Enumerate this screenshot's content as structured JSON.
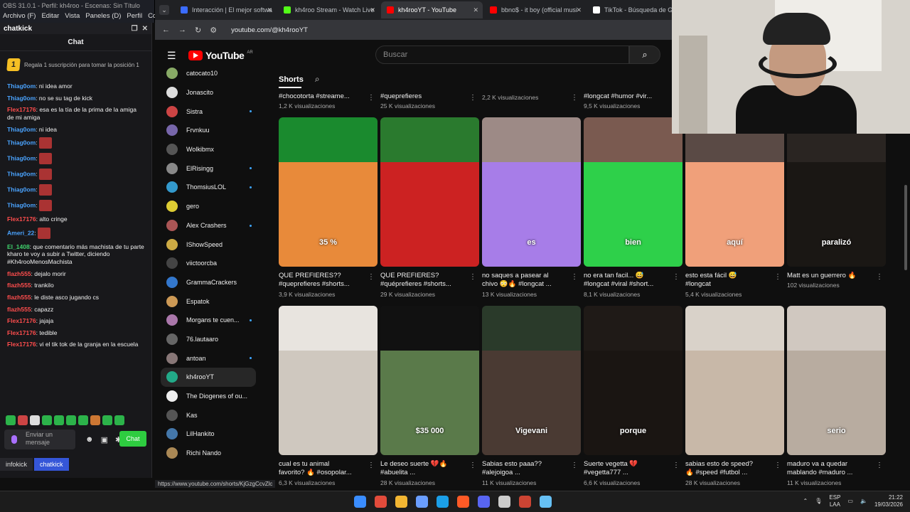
{
  "obs": {
    "title": "OBS 31.0.1 - Perfil: kh4roo - Escenas: Sin Título",
    "menu": [
      "Archivo (F)",
      "Editar",
      "Vista",
      "Paneles (D)",
      "Perfil",
      "Co"
    ]
  },
  "chat": {
    "dock_title": "chatkick",
    "header": "Chat",
    "promo_badge": "1",
    "promo_text": "Regala 1 suscripción para tomar la posición 1",
    "messages": [
      {
        "user": "Thiag0om",
        "text": ": ni idea amor",
        "color": "#4aa3ff"
      },
      {
        "user": "Thiag0om",
        "text": ": no se su tag de kick",
        "color": "#4aa3ff"
      },
      {
        "user": "Flex17176",
        "text": ": esa es la tía de la prima de la amiga de mi amiga",
        "color": "#ff4d4d"
      },
      {
        "user": "Thiag0om",
        "text": ": ni idea",
        "color": "#4aa3ff"
      },
      {
        "user": "Thiag0om",
        "text": ":",
        "color": "#4aa3ff",
        "emote": true
      },
      {
        "user": "Thiag0om",
        "text": ":",
        "color": "#4aa3ff",
        "emote": true
      },
      {
        "user": "Thiag0om",
        "text": ":",
        "color": "#4aa3ff",
        "emote": true
      },
      {
        "user": "Thiag0om",
        "text": ":",
        "color": "#4aa3ff",
        "emote": true
      },
      {
        "user": "Thiag0om",
        "text": ":",
        "color": "#4aa3ff",
        "emote": true
      },
      {
        "user": "Flex17176",
        "text": ": alto cringe",
        "color": "#ff4d4d"
      },
      {
        "user": "Ameri_22",
        "text": ":",
        "color": "#4aa3ff",
        "emote": true
      },
      {
        "user": "El_1408",
        "text": ": que comentario más machista de tu parte kharo te voy a subir a Twitter, diciendo #Kh4rooMenosMachista",
        "color": "#3fd16c"
      },
      {
        "user": "flazh555",
        "text": ": dejalo morir",
        "color": "#ff4d4d"
      },
      {
        "user": "flazh555",
        "text": ": trankilo",
        "color": "#ff4d4d"
      },
      {
        "user": "flazh555",
        "text": ": le diste asco jugando cs",
        "color": "#ff4d4d"
      },
      {
        "user": "flazh555",
        "text": ": capazz",
        "color": "#ff4d4d"
      },
      {
        "user": "Flex17176",
        "text": ": jajaja",
        "color": "#ff4d4d"
      },
      {
        "user": "Flex17176",
        "text": ": tedible",
        "color": "#ff4d4d"
      },
      {
        "user": "Flex17176",
        "text": ": vi el tik tok de la granja en la escuela",
        "color": "#ff4d4d"
      }
    ],
    "input_placeholder": "Enviar un mensaje",
    "send_label": "Chat",
    "dock_tabs": [
      "infokick",
      "chatkick"
    ]
  },
  "browser": {
    "tabs": [
      {
        "label": "Interacción | El mejor softwa",
        "color": "#3b6cff",
        "active": false
      },
      {
        "label": "kh4roo Stream - Watch Live",
        "color": "#53fc18",
        "active": false
      },
      {
        "label": "kh4rooYT - YouTube",
        "color": "#ff0000",
        "active": true
      },
      {
        "label": "bbno$ - it boy (official musi",
        "color": "#ff0000",
        "active": false
      },
      {
        "label": "TikTok - Búsqueda de Goo",
        "color": "#ffffff",
        "active": false
      }
    ],
    "url": "youtube.com/@kh4rooYT",
    "status_url": "https://www.youtube.com/shorts/KjGzgCcvZlc"
  },
  "youtube": {
    "logo_text": "YouTube",
    "country": "AR",
    "search_placeholder": "Buscar",
    "shorts_label": "Shorts",
    "subscriptions": [
      {
        "name": "catocato10",
        "color": "#8a6",
        "dot": false
      },
      {
        "name": "Jonascito",
        "color": "#ddd",
        "dot": false
      },
      {
        "name": "Sistra",
        "color": "#c44",
        "dot": true
      },
      {
        "name": "Frvnkuu",
        "color": "#76a",
        "dot": false
      },
      {
        "name": "Wolkibmx",
        "color": "#555",
        "dot": false
      },
      {
        "name": "ElRisingg",
        "color": "#888",
        "dot": true
      },
      {
        "name": "ThomsiusLOL",
        "color": "#39c",
        "dot": true
      },
      {
        "name": "gero",
        "color": "#dc3",
        "dot": false
      },
      {
        "name": "Alex Crashers",
        "color": "#a55",
        "dot": true
      },
      {
        "name": "IShowSpeed",
        "color": "#ca4",
        "dot": false
      },
      {
        "name": "viictoorcba",
        "color": "#444",
        "dot": false
      },
      {
        "name": "GrammaCrackers",
        "color": "#37c",
        "dot": false
      },
      {
        "name": "Espatok",
        "color": "#c95",
        "dot": false
      },
      {
        "name": "Morgans te cuen...",
        "color": "#a7a",
        "dot": true
      },
      {
        "name": "76.lautaaro",
        "color": "#666",
        "dot": false
      },
      {
        "name": "antoan",
        "color": "#877",
        "dot": true
      },
      {
        "name": "kh4rooYT",
        "color": "#2a8",
        "dot": false,
        "active": true
      },
      {
        "name": "The Diogenes of ou...",
        "color": "#eee",
        "dot": false
      },
      {
        "name": "Kas",
        "color": "#555",
        "dot": false
      },
      {
        "name": "LilHankito",
        "color": "#47a",
        "dot": false
      },
      {
        "name": "Richi Nando",
        "color": "#a85",
        "dot": false
      }
    ],
    "row0": [
      {
        "title": "#chocotorta #streame...",
        "views": "1,2 K visualizaciones"
      },
      {
        "title": "#queprefieres",
        "views": "25 K visualizaciones"
      },
      {
        "title": "",
        "views": "2,2 K visualizaciones"
      },
      {
        "title": "#longcat #humor #vir...",
        "views": "9,5 K visualizaciones"
      }
    ],
    "row1": [
      {
        "line1": "QUE PREFIERES??",
        "line2": "#queprefieres #shorts...",
        "views": "3,9 K visualizaciones",
        "overlay": "35 %",
        "c1": "#1a8a2e",
        "c2": "#e88a3a"
      },
      {
        "line1": "QUE PREFIERES?",
        "line2": "#quéprefieres #shorts...",
        "views": "29 K visualizaciones",
        "overlay": "",
        "c1": "#2a7a2e",
        "c2": "#c22"
      },
      {
        "line1": "no saques a pasear al",
        "line2": "chivo 😳🔥 #longcat ...",
        "views": "13 K visualizaciones",
        "overlay": "es",
        "c1": "#9d8a86",
        "c2": "#a77de8"
      },
      {
        "line1": "no era tan facil... 😅",
        "line2": "#longcat #viral #short...",
        "views": "8,1 K visualizaciones",
        "overlay": "bien",
        "c1": "#7a5a50",
        "c2": "#2ed04a"
      },
      {
        "line1": "esto esta fácil 😅",
        "line2": "#longcat",
        "views": "5,4 K visualizaciones",
        "overlay": "aquí",
        "c1": "#5a4a45",
        "c2": "#f0a07a"
      },
      {
        "line1": "Matt es un guerrero 🔥",
        "line2": "",
        "views": "102 visualizaciones",
        "overlay": "paralizó",
        "c1": "#2a2522",
        "c2": "#1a1714"
      }
    ],
    "row2": [
      {
        "line1": "cual es tu animal",
        "line2": "favorito? 🔥 #osopolar...",
        "views": "6,3 K visualizaciones",
        "overlay": "",
        "c1": "#e8e4df",
        "c2": "#cfc8bf"
      },
      {
        "line1": "Le deseo suerte 💔🔥",
        "line2": "#abuelita ...",
        "views": "28 K visualizaciones",
        "overlay": "$35 000",
        "c1": "#111",
        "c2": "#5a7a4a"
      },
      {
        "line1": "Sabias esto paaa??",
        "line2": "#alejoigoa ...",
        "views": "11 K visualizaciones",
        "overlay": "Vigevani",
        "c1": "#2a3a2a",
        "c2": "#4a3a33"
      },
      {
        "line1": "Suerte vegetta 💔",
        "line2": "#vegetta777 ...",
        "views": "6,6 K visualizaciones",
        "overlay": "porque",
        "c1": "#1f1a17",
        "c2": "#1a1512"
      },
      {
        "line1": "sabias esto de speed?",
        "line2": "🔥 #speed #futbol ...",
        "views": "28 K visualizaciones",
        "overlay": "",
        "c1": "#d9d2c9",
        "c2": "#c8b8a8"
      },
      {
        "line1": "maduro va a quedar",
        "line2": "mablando #maduro ...",
        "views": "11 K visualizaciones",
        "overlay": "serio",
        "c1": "#d0c8c0",
        "c2": "#b8aca0"
      }
    ]
  },
  "taskbar": {
    "icon_colors": [
      "#3a8dff",
      "#e24b3b",
      "#f3b632",
      "#6a9eff",
      "#1b9fe8",
      "#ff5a26",
      "#5865f2",
      "#cccccc",
      "#c43",
      "#66c0f4"
    ],
    "lang": "ESP",
    "lang2": "LAA",
    "time": "21:22",
    "date": "19/03/2026"
  }
}
